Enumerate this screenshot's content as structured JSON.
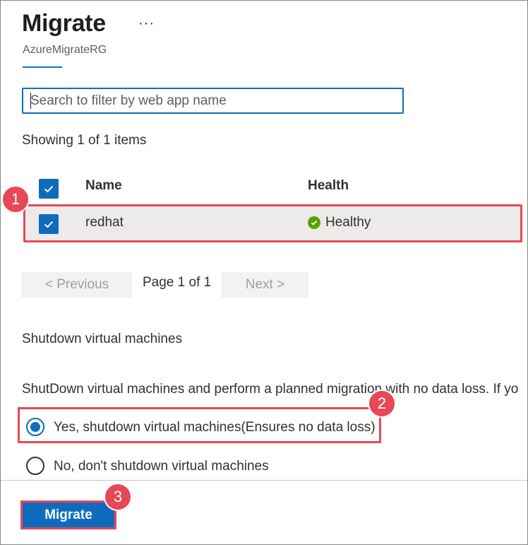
{
  "header": {
    "title": "Migrate",
    "more_label": "···",
    "subtitle": "AzureMigrateRG"
  },
  "search": {
    "placeholder": "Search to filter by web app name",
    "value": ""
  },
  "status": {
    "showing_text": "Showing 1 of 1 items"
  },
  "table": {
    "columns": [
      "Name",
      "Health"
    ],
    "rows": [
      {
        "name": "redhat",
        "health": "Healthy",
        "selected": true
      }
    ]
  },
  "pager": {
    "previous_label": "< Previous",
    "page_label": "Page 1 of 1",
    "next_label": "Next >"
  },
  "shutdown": {
    "heading": "Shutdown virtual machines",
    "description": "ShutDown virtual machines and perform a planned migration with no data loss. If yo",
    "options": [
      {
        "label": "Yes, shutdown virtual machines(Ensures no data loss)",
        "selected": true
      },
      {
        "label": "No, don't shutdown virtual machines",
        "selected": false
      }
    ]
  },
  "badges": [
    "1",
    "2",
    "3"
  ],
  "footer": {
    "migrate_label": "Migrate"
  },
  "colors": {
    "accent": "#0f6cbd",
    "highlight": "#e74856",
    "healthy": "#57a300",
    "row_bg": "#edebe9"
  },
  "icons": {
    "checkbox": "checkmark-icon",
    "health": "check-circle-icon",
    "more": "ellipsis-icon"
  }
}
